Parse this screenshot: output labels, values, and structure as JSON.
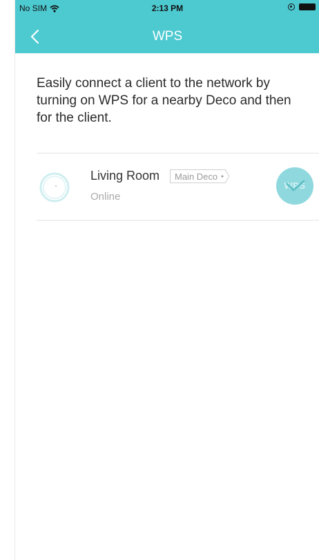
{
  "status_bar": {
    "carrier": "No SIM",
    "time": "2:13 PM"
  },
  "nav": {
    "title": "WPS",
    "back_icon": "chevron-left-icon"
  },
  "intro_text": "Easily connect a client to the network by turning on WPS for a nearby Deco and then for the client.",
  "device": {
    "name": "Living Room",
    "badge": "Main Deco",
    "status": "Online",
    "icon": "deco-device-icon",
    "wps_label": "WPS",
    "wps_state_icon": "checkmark-icon"
  },
  "colors": {
    "header": "#4dc9d0",
    "wps_button": "#8fd8dd",
    "text_primary": "#2a2a2a",
    "text_muted": "#aaaaaa"
  }
}
